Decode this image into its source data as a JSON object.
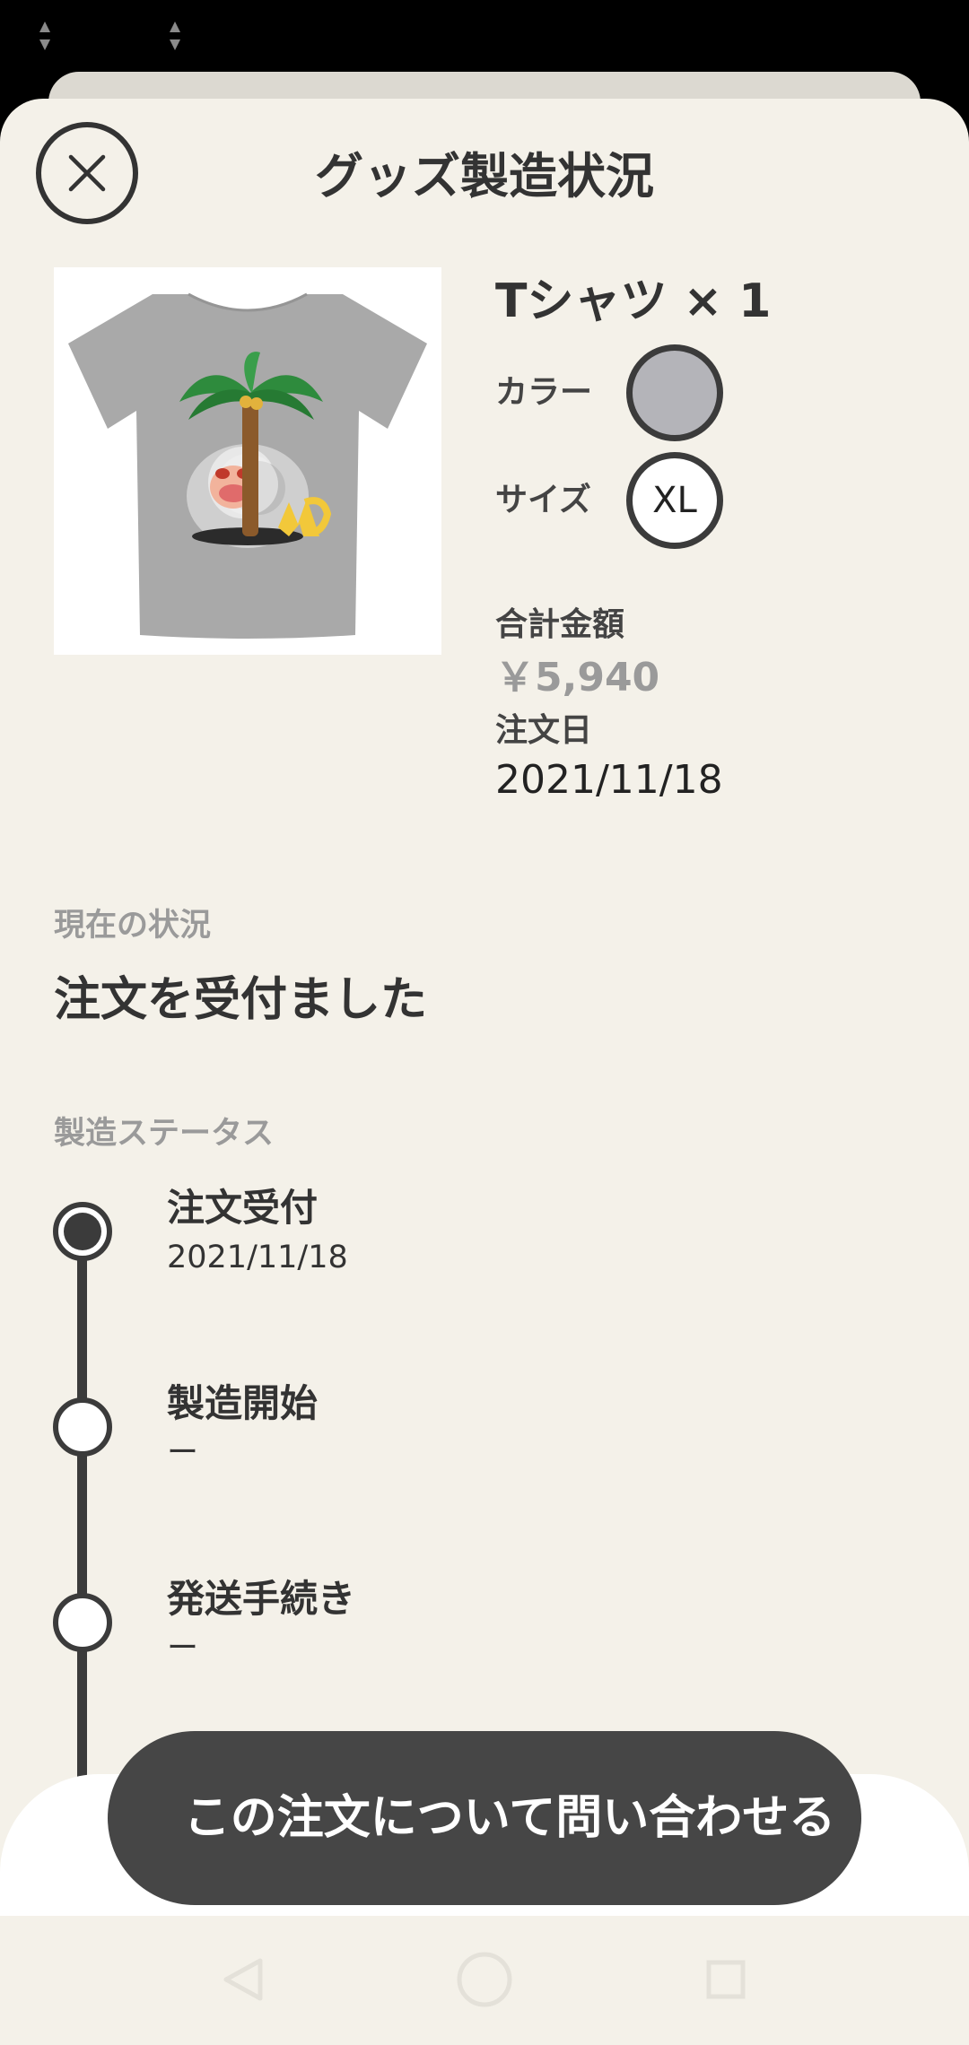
{
  "header": {
    "title": "グッズ製造状況",
    "close_icon": "close-icon"
  },
  "product": {
    "name": "Tシャツ × 1",
    "color_label": "カラー",
    "color_value": "#b4b4b9",
    "size_label": "サイズ",
    "size_value": "XL",
    "total_label": "合計金額",
    "total_value": "￥5,940",
    "order_date_label": "注文日",
    "order_date_value": "2021/11/18"
  },
  "status": {
    "current_label": "現在の状況",
    "current_value": "注文を受付ました",
    "progress_label": "製造ステータス",
    "steps": [
      {
        "title": "注文受付",
        "date": "2021/11/18",
        "done": true
      },
      {
        "title": "製造開始",
        "date": "ー",
        "done": false
      },
      {
        "title": "発送手続き",
        "date": "ー",
        "done": false
      }
    ]
  },
  "actions": {
    "contact_label": "この注文について問い合わせる"
  },
  "nav": {
    "back_icon": "back-triangle-icon",
    "home_icon": "home-circle-icon",
    "recents_icon": "recents-square-icon"
  },
  "colors": {
    "background": "#f4f1e9",
    "dark": "#464646",
    "muted_text": "#9a9a9a",
    "tshirt": "#a9a9a9"
  }
}
